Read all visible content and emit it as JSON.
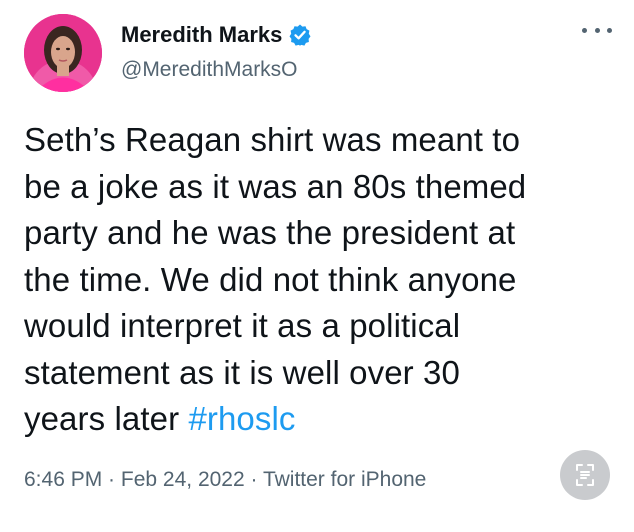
{
  "author": {
    "display_name": "Meredith Marks",
    "handle": "@MeredithMarksO",
    "verified_icon": "verified-badge-icon"
  },
  "tweet": {
    "text_before_hashtag": "Seth’s Reagan shirt was meant to\nbe a joke as it was an 80s themed\nparty and he was the president at\nthe time.  We did not think anyone\nwould interpret it as a political\nstatement as it is well over 30\nyears later ",
    "hashtag": "#rhoslc",
    "time": "6:46 PM",
    "separator1": " · ",
    "date": "Feb 24, 2022",
    "separator2": " · ",
    "source": "Twitter for iPhone"
  },
  "colors": {
    "link": "#1d9bf0",
    "secondary_text": "#536471",
    "primary_text": "#0f1419",
    "avatar_bg": "#e8338f"
  },
  "icons": {
    "more": "more-options-icon",
    "translate": "translate-icon"
  }
}
